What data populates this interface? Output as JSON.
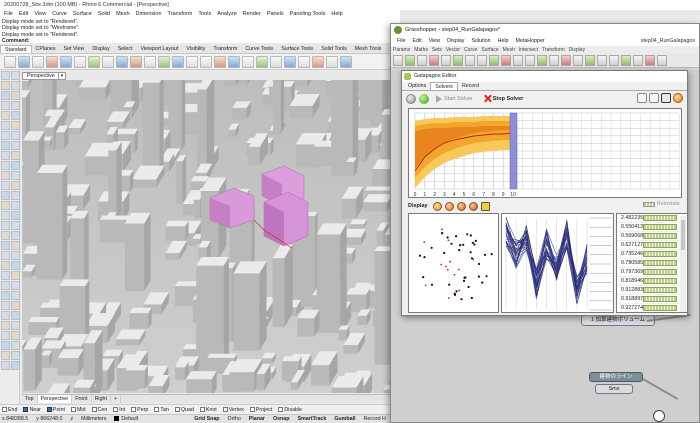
{
  "rhino": {
    "title": "20200728_Site.3dm (100 MB) - Rhino 6 Commercial - [Perspective]",
    "menu": [
      "File",
      "Edit",
      "View",
      "Curve",
      "Surface",
      "Solid",
      "Mesh",
      "Dimension",
      "Transform",
      "Tools",
      "Analyze",
      "Render",
      "Panels",
      "Paneling Tools",
      "Help"
    ],
    "command_history": [
      "Display mode set to \"Rendered\".",
      "Display mode set to \"Wireframe\".",
      "Display mode set to \"Rendered\"."
    ],
    "command_prompt": "Command:",
    "tabs": [
      "Standard",
      "CPlanes",
      "Set View",
      "Display",
      "Select",
      "Viewport Layout",
      "Visibility",
      "Transform",
      "Curve Tools",
      "Surface Tools",
      "Solid Tools",
      "Mesh Tools",
      "Render Tools"
    ],
    "active_tab": "Standard",
    "viewport_label": "Perspective",
    "viewport_tabs": [
      "Top",
      "Perspective",
      "Front",
      "Right"
    ],
    "active_viewport_tab": "Perspective",
    "add_viewport_tab": "+",
    "osnaps": [
      {
        "label": "End",
        "on": false
      },
      {
        "label": "Near",
        "on": true
      },
      {
        "label": "Point",
        "on": true
      },
      {
        "label": "Mid",
        "on": false
      },
      {
        "label": "Cen",
        "on": false
      },
      {
        "label": "Int",
        "on": false
      },
      {
        "label": "Perp",
        "on": false
      },
      {
        "label": "Tan",
        "on": false
      },
      {
        "label": "Quad",
        "on": false
      },
      {
        "label": "Knot",
        "on": false
      },
      {
        "label": "Vertex",
        "on": false
      },
      {
        "label": "Project",
        "on": false
      },
      {
        "label": "Disable",
        "on": false
      }
    ],
    "status": {
      "x": "x 848288.5",
      "y": "y 866248.0",
      "z": "z",
      "units": "Millimeters",
      "layer": "Default",
      "toggles": [
        "Grid Snap",
        "Ortho",
        "Planar",
        "Osnap",
        "SmartTrack",
        "Gumball",
        "Record H"
      ]
    }
  },
  "grasshopper": {
    "title": "Grasshopper - step04_RunGalapagos*",
    "menu": [
      "File",
      "Edit",
      "View",
      "Display",
      "Solution",
      "Help",
      "MetaHopper"
    ],
    "document": "step04_RunGalapagos",
    "tabs": [
      "Params",
      "Maths",
      "Sets",
      "Vector",
      "Curve",
      "Surface",
      "Mesh",
      "Intersect",
      "Transform",
      "Display"
    ],
    "canvas_labels": {
      "node1": "建物のライン",
      "node2": "Sms",
      "node3": "1 加算建物ボリューム"
    }
  },
  "galapagos": {
    "title": "Galapagos Editor",
    "tabs": [
      "Options",
      "Solvers",
      "Record"
    ],
    "active_tab": "Solvers",
    "start_label": "Start Solver",
    "stop_label": "Stop Solver",
    "display_label": "Display",
    "reinstate_label": "Reinstate",
    "generation_ticks": [
      "0",
      "1",
      "2",
      "3",
      "4",
      "5",
      "6",
      "7",
      "8",
      "9",
      "10"
    ],
    "values": [
      "2.482235",
      "0.550413",
      "0.569068",
      "0.627127",
      "0.735246",
      "0.780585",
      "0.797369",
      "0.818946",
      "0.912883",
      "0.918897",
      "0.927274"
    ],
    "colors": {
      "band_outer": "#f7c85a",
      "band_mid": "#f2a72c",
      "band_inner": "#e8851d",
      "mean_line": "#b4241d",
      "current_gen": "#8f8fd8"
    }
  }
}
